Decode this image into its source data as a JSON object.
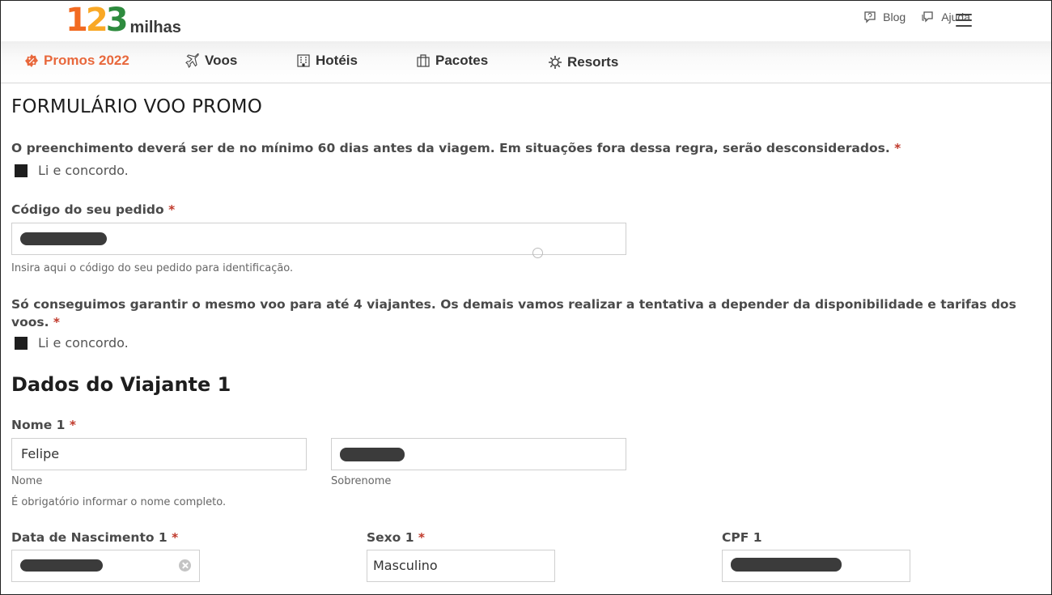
{
  "header": {
    "logo": {
      "digit1": "1",
      "digit2": "2",
      "digit3": "3",
      "word": "milhas"
    },
    "links": {
      "blog": "Blog",
      "help": "Ajuda"
    }
  },
  "nav": {
    "promos": "Promos 2022",
    "voos": "Voos",
    "hoteis": "Hotéis",
    "pacotes": "Pacotes",
    "resorts": "Resorts"
  },
  "form": {
    "title": "FORMULÁRIO VOO PROMO",
    "rule1": {
      "text": "O preenchimento deverá ser de no mínimo 60 dias antes da viagem. Em situações fora dessa regra, serão desconsiderados.",
      "required_mark": "*",
      "checkbox_label": "Li e concordo."
    },
    "order": {
      "label": "Código do seu pedido",
      "required_mark": "*",
      "help": "Insira aqui o código do seu pedido para identificação."
    },
    "rule2": {
      "text": "Só conseguimos garantir o mesmo voo para até 4 viajantes. Os demais vamos realizar a tentativa a depender da disponibilidade e tarifas dos voos.",
      "required_mark": "*",
      "checkbox_label": "Li e concordo."
    },
    "traveler": {
      "section_title": "Dados do Viajante 1",
      "name_label": "Nome 1",
      "name_required": "*",
      "first_name_value": "Felipe",
      "first_name_caption": "Nome",
      "last_name_caption": "Sobrenome",
      "name_help": "É obrigatório informar o nome completo.",
      "birth_label": "Data de Nascimento 1",
      "birth_required": "*",
      "sex_label": "Sexo 1",
      "sex_required": "*",
      "sex_value": "Masculino",
      "cpf_label": "CPF 1"
    }
  },
  "colors": {
    "promo_accent": "#e8683c",
    "required": "#c0392b",
    "logo_orange": "#f26a21",
    "logo_yellow": "#f9a825",
    "logo_green": "#2e8b3e"
  }
}
